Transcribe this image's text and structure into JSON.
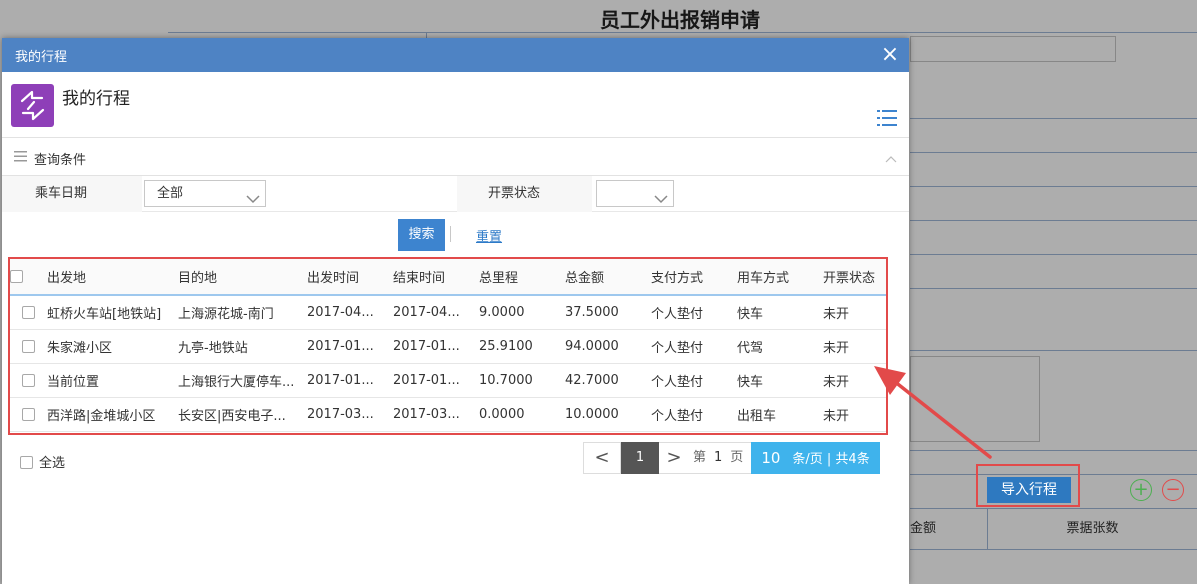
{
  "background": {
    "page_title": "员工外出报销申请",
    "import_button": "导入行程",
    "plus_symbol": "+",
    "minus_symbol": "−",
    "table_headers": {
      "amount": "金额",
      "receipt_count": "票据张数"
    }
  },
  "dialog": {
    "window_title": "我的行程",
    "close_symbol": "×",
    "app_title": "我的行程",
    "query": {
      "section_title": "查询条件",
      "date_label": "乘车日期",
      "date_value": "全部",
      "invoice_label": "开票状态",
      "invoice_value": "",
      "search_button": "搜索",
      "reset_link": "重置"
    },
    "table": {
      "columns": [
        "出发地",
        "目的地",
        "出发时间",
        "结束时间",
        "总里程",
        "总金额",
        "支付方式",
        "用车方式",
        "开票状态"
      ],
      "rows": [
        [
          "虹桥火车站[地铁站]",
          "上海源花城-南门",
          "2017-04...",
          "2017-04...",
          "9.0000",
          "37.5000",
          "个人垫付",
          "快车",
          "未开"
        ],
        [
          "朱家滩小区",
          "九亭-地铁站",
          "2017-01...",
          "2017-01...",
          "25.9100",
          "94.0000",
          "个人垫付",
          "代驾",
          "未开"
        ],
        [
          "当前位置",
          "上海银行大厦停车...",
          "2017-01...",
          "2017-01...",
          "10.7000",
          "42.7000",
          "个人垫付",
          "快车",
          "未开"
        ],
        [
          "西洋路|金堆城小区",
          "长安区|西安电子...",
          "2017-03...",
          "2017-03...",
          "0.0000",
          "10.0000",
          "个人垫付",
          "出租车",
          "未开"
        ]
      ]
    },
    "footer": {
      "select_all": "全选",
      "pager": {
        "prev": "<",
        "current_page": "1",
        "next": ">",
        "page_prefix": "第",
        "page_number": "1",
        "page_suffix": "页",
        "page_size": "10",
        "summary": "条/页 | 共4条"
      }
    }
  },
  "colors": {
    "dialog_header": "#4e83c4",
    "search_button": "#3d84cf",
    "highlight_red": "#e24a4a",
    "pager_size_bg": "#3fb3ec",
    "app_icon_bg": "#8e3fb8"
  }
}
